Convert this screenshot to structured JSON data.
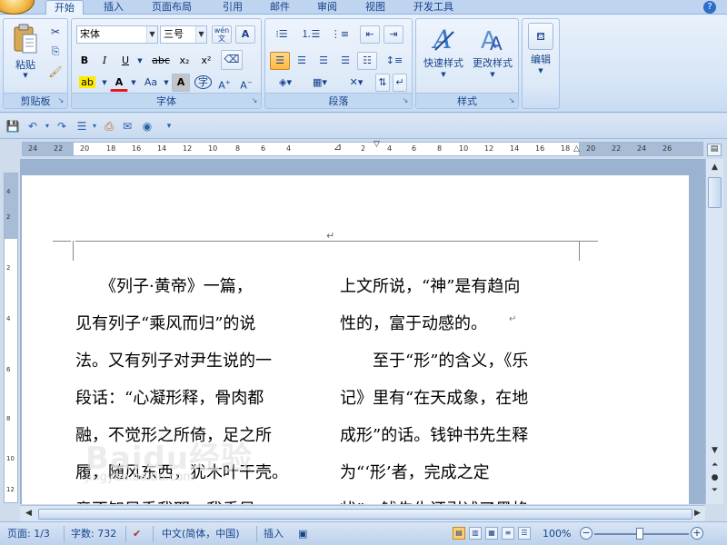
{
  "tabs": [
    "开始",
    "插入",
    "页面布局",
    "引用",
    "邮件",
    "审阅",
    "视图",
    "开发工具"
  ],
  "ribbon": {
    "clipboard": {
      "label": "剪贴板",
      "paste": "粘贴"
    },
    "font": {
      "label": "字体",
      "face": "宋体",
      "size": "三号",
      "wen": "wén",
      "bold": "B",
      "italic": "I",
      "underline": "U",
      "strike": "abc",
      "sub": "x₂",
      "sup": "x²",
      "Aa": "Aa"
    },
    "paragraph": {
      "label": "段落"
    },
    "styles": {
      "label": "样式",
      "quick": "快速样式",
      "change": "更改样式"
    },
    "editing": {
      "label": "编辑"
    }
  },
  "ruler": {
    "h_left_ticks": [
      "24",
      "22",
      "20",
      "18",
      "16",
      "14",
      "12",
      "10",
      "8",
      "6",
      "4"
    ],
    "h_right_ticks": [
      "2",
      "4",
      "6",
      "8",
      "10",
      "12",
      "14",
      "16",
      "18",
      "20",
      "22",
      "24",
      "26"
    ],
    "v_ticks": [
      "4",
      "2",
      "2",
      "4",
      "6",
      "8",
      "10",
      "12"
    ]
  },
  "document": {
    "left_column": [
      "　　《列子·黄帝》一篇，",
      "见有列子“乘风而归”的说",
      "法。又有列子对尹生说的一",
      "段话：“心凝形释，骨肉都",
      "融，不觉形之所倚，足之所",
      "履，随风东西，犹木叶干壳。",
      "竟不知风乘我耶，我乘风"
    ],
    "right_column": [
      "上文所说，“神”是有趋向",
      "性的，富于动感的。",
      "　　至于“形”的含义，《乐",
      "记》里有“在天成象，在地",
      "成形”的话。钱钟书先生释",
      "为“‘形’者，完成之定",
      "状”，钱先生还引述了黑格"
    ],
    "return_mark": "↵",
    "watermark": "Baidu经验",
    "watermark_url": "jingyan.baidu.com"
  },
  "status": {
    "page": "页面: 1/3",
    "words": "字数: 732",
    "language": "中文(简体，中国)",
    "mode": "插入",
    "zoom": "100%"
  }
}
